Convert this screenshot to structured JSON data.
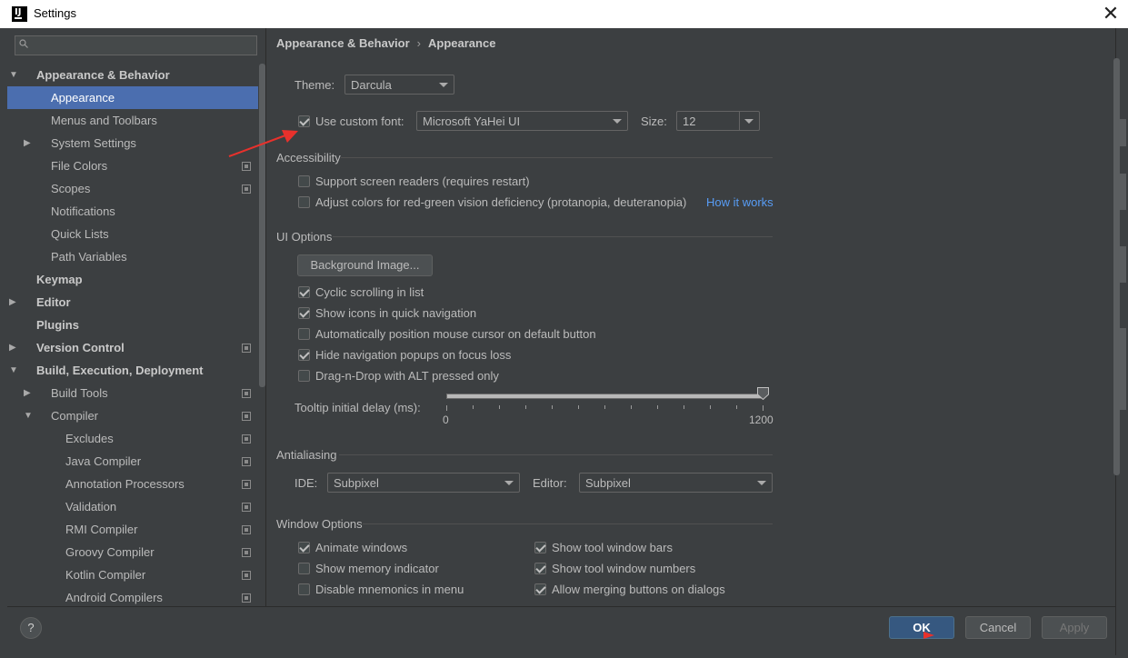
{
  "window": {
    "title": "Settings",
    "close_glyph": "✕"
  },
  "search": {
    "placeholder": "",
    "value": ""
  },
  "sidebar": {
    "items": [
      {
        "label": "Appearance & Behavior",
        "bold": true,
        "depth": 0,
        "arrow": "down",
        "cfg": false
      },
      {
        "label": "Appearance",
        "bold": false,
        "depth": 1,
        "arrow": "none",
        "cfg": false,
        "selected": true
      },
      {
        "label": "Menus and Toolbars",
        "bold": false,
        "depth": 1,
        "arrow": "none",
        "cfg": false
      },
      {
        "label": "System Settings",
        "bold": false,
        "depth": 1,
        "arrow": "right",
        "cfg": false
      },
      {
        "label": "File Colors",
        "bold": false,
        "depth": 1,
        "arrow": "none",
        "cfg": true
      },
      {
        "label": "Scopes",
        "bold": false,
        "depth": 1,
        "arrow": "none",
        "cfg": true
      },
      {
        "label": "Notifications",
        "bold": false,
        "depth": 1,
        "arrow": "none",
        "cfg": false
      },
      {
        "label": "Quick Lists",
        "bold": false,
        "depth": 1,
        "arrow": "none",
        "cfg": false
      },
      {
        "label": "Path Variables",
        "bold": false,
        "depth": 1,
        "arrow": "none",
        "cfg": false
      },
      {
        "label": "Keymap",
        "bold": true,
        "depth": 0,
        "arrow": "none",
        "cfg": false
      },
      {
        "label": "Editor",
        "bold": true,
        "depth": 0,
        "arrow": "right",
        "cfg": false
      },
      {
        "label": "Plugins",
        "bold": true,
        "depth": 0,
        "arrow": "none",
        "cfg": false
      },
      {
        "label": "Version Control",
        "bold": true,
        "depth": 0,
        "arrow": "right",
        "cfg": true
      },
      {
        "label": "Build, Execution, Deployment",
        "bold": true,
        "depth": 0,
        "arrow": "down",
        "cfg": false
      },
      {
        "label": "Build Tools",
        "bold": false,
        "depth": 1,
        "arrow": "right",
        "cfg": true
      },
      {
        "label": "Compiler",
        "bold": false,
        "depth": 1,
        "arrow": "down",
        "cfg": true
      },
      {
        "label": "Excludes",
        "bold": false,
        "depth": 2,
        "arrow": "none",
        "cfg": true
      },
      {
        "label": "Java Compiler",
        "bold": false,
        "depth": 2,
        "arrow": "none",
        "cfg": true
      },
      {
        "label": "Annotation Processors",
        "bold": false,
        "depth": 2,
        "arrow": "none",
        "cfg": true
      },
      {
        "label": "Validation",
        "bold": false,
        "depth": 2,
        "arrow": "none",
        "cfg": true
      },
      {
        "label": "RMI Compiler",
        "bold": false,
        "depth": 2,
        "arrow": "none",
        "cfg": true
      },
      {
        "label": "Groovy Compiler",
        "bold": false,
        "depth": 2,
        "arrow": "none",
        "cfg": true
      },
      {
        "label": "Kotlin Compiler",
        "bold": false,
        "depth": 2,
        "arrow": "none",
        "cfg": true
      },
      {
        "label": "Android Compilers",
        "bold": false,
        "depth": 2,
        "arrow": "none",
        "cfg": true
      }
    ]
  },
  "breadcrumb": {
    "parent": "Appearance & Behavior",
    "separator": "›",
    "current": "Appearance"
  },
  "theme": {
    "label": "Theme:",
    "value": "Darcula"
  },
  "font": {
    "checkbox_label": "Use custom font:",
    "checked": true,
    "value": "Microsoft YaHei UI",
    "size_label": "Size:",
    "size_value": "12"
  },
  "accessibility": {
    "title": "Accessibility",
    "screen_readers": {
      "label": "Support screen readers (requires restart)",
      "checked": false
    },
    "color_deficiency": {
      "label": "Adjust colors for red-green vision deficiency (protanopia, deuteranopia)",
      "checked": false
    },
    "how_it_works": "How it works"
  },
  "ui_options": {
    "title": "UI Options",
    "background_button": "Background Image...",
    "options": [
      {
        "label": "Cyclic scrolling in list",
        "checked": true
      },
      {
        "label": "Show icons in quick navigation",
        "checked": true
      },
      {
        "label": "Automatically position mouse cursor on default button",
        "checked": false
      },
      {
        "label": "Hide navigation popups on focus loss",
        "checked": true
      },
      {
        "label": "Drag-n-Drop with ALT pressed only",
        "checked": false
      }
    ],
    "tooltip_label": "Tooltip initial delay (ms):",
    "tooltip_min": "0",
    "tooltip_max": "1200",
    "tooltip_value": 1200
  },
  "antialiasing": {
    "title": "Antialiasing",
    "ide_label": "IDE:",
    "ide_value": "Subpixel",
    "editor_label": "Editor:",
    "editor_value": "Subpixel"
  },
  "window_options": {
    "title": "Window Options",
    "left": [
      {
        "label": "Animate windows",
        "checked": true
      },
      {
        "label": "Show memory indicator",
        "checked": false
      },
      {
        "label": "Disable mnemonics in menu",
        "checked": false
      }
    ],
    "right": [
      {
        "label": "Show tool window bars",
        "checked": true
      },
      {
        "label": "Show tool window numbers",
        "checked": true
      },
      {
        "label": "Allow merging buttons on dialogs",
        "checked": true
      }
    ]
  },
  "footer": {
    "help": "?",
    "ok": "OK",
    "cancel": "Cancel",
    "apply": "Apply"
  },
  "colors": {
    "accent": "#4b6eaf",
    "annotation": "#e8312c",
    "link": "#589df6"
  }
}
